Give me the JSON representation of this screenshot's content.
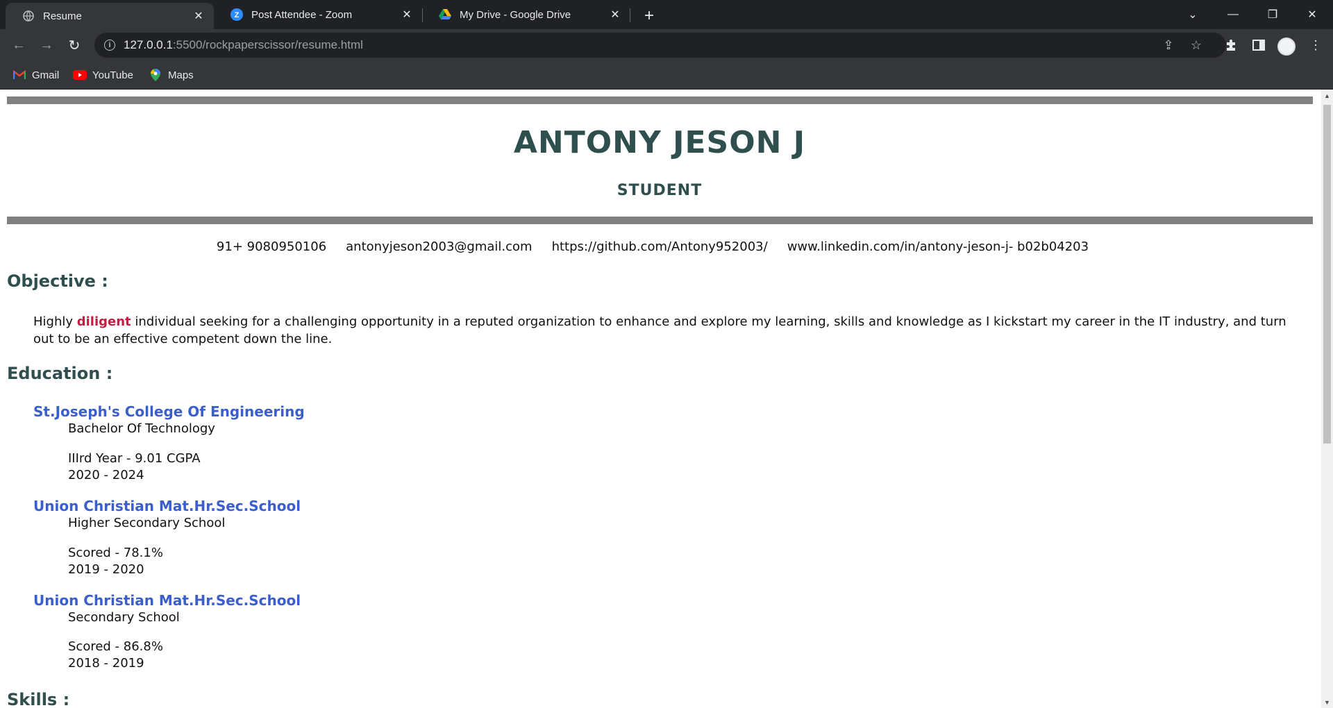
{
  "browser": {
    "tabs": [
      {
        "title": "Resume",
        "icon": "globe-icon",
        "active": true
      },
      {
        "title": "Post Attendee - Zoom",
        "icon": "zoom-icon",
        "active": false
      },
      {
        "title": "My Drive - Google Drive",
        "icon": "google-drive-icon",
        "active": false
      }
    ],
    "address": {
      "host": "127.0.0.1",
      "path": ":5500/rockpaperscissor/resume.html"
    },
    "bookmarks": [
      {
        "label": "Gmail",
        "icon": "gmail-icon"
      },
      {
        "label": "YouTube",
        "icon": "youtube-icon"
      },
      {
        "label": "Maps",
        "icon": "maps-icon"
      }
    ]
  },
  "resume": {
    "name": "ANTONY JESON J",
    "role": "STUDENT",
    "contacts": {
      "phone": "91+ 9080950106",
      "email": "antonyjeson2003@gmail.com",
      "github": "https://github.com/Antony952003/",
      "linkedin": "www.linkedin.com/in/antony-jeson-j- b02b04203"
    },
    "objective": {
      "title": "Objective :",
      "before": "Highly ",
      "highlight": "diligent",
      "after": " individual seeking for a challenging opportunity in a reputed organization to enhance and explore my learning, skills and knowledge as I kickstart my career in the IT industry, and turn out to be an effective competent down the line."
    },
    "education": {
      "title": "Education :",
      "entries": [
        {
          "school": "St.Joseph's College Of Engineering",
          "degree": "Bachelor Of Technology",
          "score": "IIIrd Year - 9.01 CGPA",
          "years": "2020 - 2024"
        },
        {
          "school": "Union Christian Mat.Hr.Sec.School",
          "degree": "Higher Secondary School",
          "score": "Scored - 78.1%",
          "years": "2019 - 2020"
        },
        {
          "school": "Union Christian Mat.Hr.Sec.School",
          "degree": "Secondary School",
          "score": "Scored - 86.8%",
          "years": "2018 - 2019"
        }
      ]
    },
    "skills": {
      "title": "Skills :"
    }
  },
  "colors": {
    "heading": "#2f4f4f",
    "school": "#3a5fcd",
    "highlight": "#c21e43",
    "rule": "#808080"
  }
}
